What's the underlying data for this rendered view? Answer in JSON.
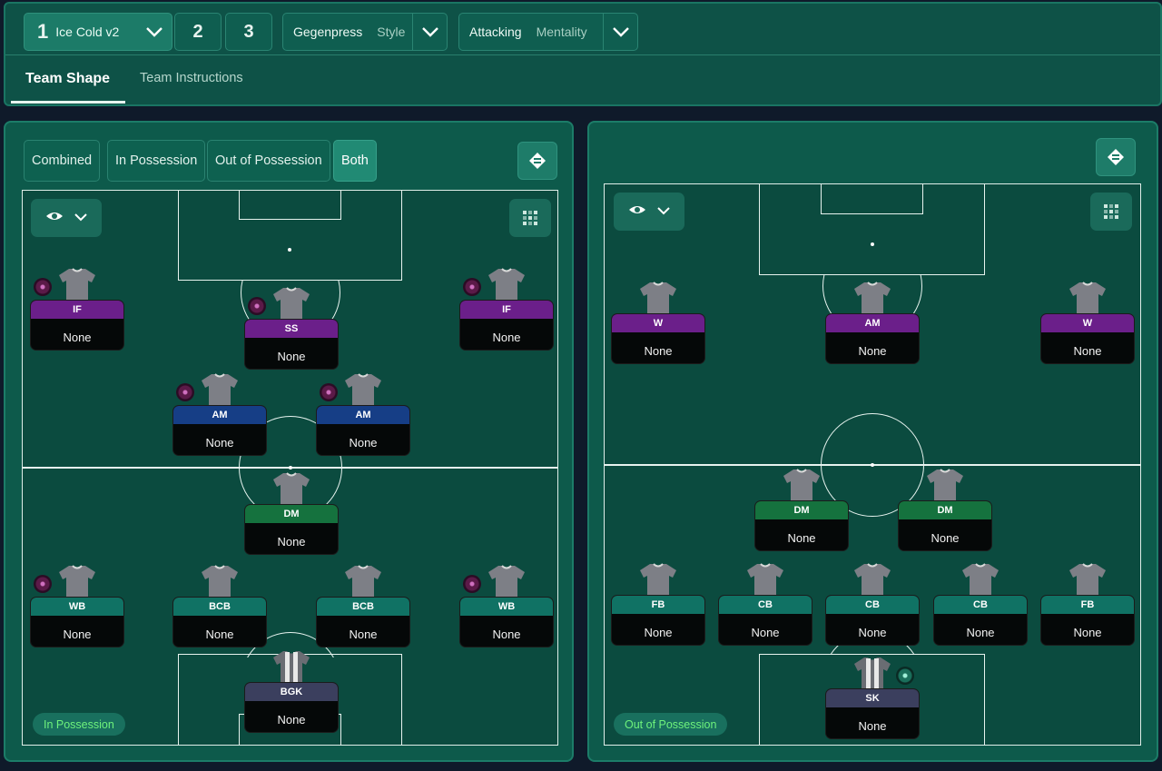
{
  "tactics": {
    "slot1": {
      "number": "1",
      "name": "Ice Cold v2"
    },
    "slot2": "2",
    "slot3": "3"
  },
  "style": {
    "value": "Gegenpress",
    "label": "Style"
  },
  "mentality": {
    "value": "Attacking",
    "label": "Mentality"
  },
  "tabs": {
    "team_shape": "Team Shape",
    "team_instructions": "Team Instructions"
  },
  "left_panel": {
    "filters": [
      "Combined",
      "In Possession",
      "Out of Possession",
      "Both"
    ],
    "active_filter": "Both",
    "phase_label": "In Possession",
    "players": [
      {
        "role": "IF",
        "assignment": "None",
        "group": "att"
      },
      {
        "role": "SS",
        "assignment": "None",
        "group": "att"
      },
      {
        "role": "IF",
        "assignment": "None",
        "group": "att"
      },
      {
        "role": "AM",
        "assignment": "None",
        "group": "mid"
      },
      {
        "role": "AM",
        "assignment": "None",
        "group": "mid"
      },
      {
        "role": "DM",
        "assignment": "None",
        "group": "dm"
      },
      {
        "role": "WB",
        "assignment": "None",
        "group": "def"
      },
      {
        "role": "BCB",
        "assignment": "None",
        "group": "def"
      },
      {
        "role": "BCB",
        "assignment": "None",
        "group": "def"
      },
      {
        "role": "WB",
        "assignment": "None",
        "group": "def"
      },
      {
        "role": "BGK",
        "assignment": "None",
        "group": "gk"
      }
    ]
  },
  "right_panel": {
    "phase_label": "Out of Possession",
    "players": [
      {
        "role": "W",
        "assignment": "None",
        "group": "att"
      },
      {
        "role": "AM",
        "assignment": "None",
        "group": "att"
      },
      {
        "role": "W",
        "assignment": "None",
        "group": "att"
      },
      {
        "role": "DM",
        "assignment": "None",
        "group": "dm"
      },
      {
        "role": "DM",
        "assignment": "None",
        "group": "dm"
      },
      {
        "role": "FB",
        "assignment": "None",
        "group": "def"
      },
      {
        "role": "CB",
        "assignment": "None",
        "group": "def"
      },
      {
        "role": "CB",
        "assignment": "None",
        "group": "def"
      },
      {
        "role": "CB",
        "assignment": "None",
        "group": "def"
      },
      {
        "role": "FB",
        "assignment": "None",
        "group": "def"
      },
      {
        "role": "SK",
        "assignment": "None",
        "group": "gk"
      }
    ]
  },
  "colors": {
    "attack_role": "#6b1f8a",
    "midfield_role": "#163e86",
    "dm_role": "#15723e",
    "defence_role": "#107264",
    "goalkeeper_role": "#3b3f5e",
    "phase_text": "#6ef27c"
  },
  "icons": [
    "chevron-down-icon",
    "eye-icon",
    "formation-grid-icon",
    "swap-pitch-icon",
    "shirt-icon",
    "role-badge-icon"
  ]
}
